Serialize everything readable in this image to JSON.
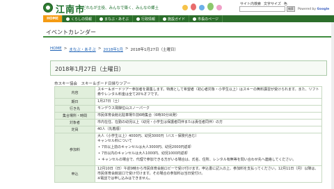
{
  "header": {
    "site_name": "江南市",
    "tagline": "だれもが主役、みんなで築く、みんなの郷土",
    "links": [
      "サイト内検索",
      "文字サイズ",
      "色"
    ],
    "search_button": "検索",
    "powered_label": "Powered by",
    "powered_brand": "Google"
  },
  "nav": {
    "items": [
      "HOME",
      "くらしの情報",
      "まなぶ・あそぶ",
      "行政情報",
      "施設ガイド",
      "市長のページ"
    ]
  },
  "page": {
    "heading": "イベントカレンダー"
  },
  "breadcrumb": {
    "items": [
      "HOME",
      "まなぶ・あそぶ",
      "2018年1月",
      "2018年1月27日（土曜日）"
    ],
    "separator": ">"
  },
  "event": {
    "date_title": "2018年1月27日（土曜日）",
    "name": "市スキー協会　スキー＆ボード日帰りツアー",
    "rows": [
      {
        "label": "内容",
        "value": "スキー＆ボードツアー参加者を募集します。特典として希望者（初心者対象・小学生以上）はスキーの無料講習が受けられます。また、リフト券やレンタル料金は全て20％オフです。"
      },
      {
        "label": "期日",
        "value": "1月27日（土）"
      },
      {
        "label": "行き先",
        "value": "モンデウス飛騨位山スノーパーク"
      },
      {
        "label": "集合場所・時間",
        "value": "市民体育会館北駐車場午前6時集合（6時30分出発）"
      },
      {
        "label": "対象者",
        "value": "市内在住、在勤の幼児以上（幼児・小学生は保護者同伴または責任者同伴）の方"
      },
      {
        "label": "定員",
        "value": "40人（先着順）"
      },
      {
        "label": "参加料",
        "value": "大人（小学生以上）4000円、幼児3000円（バス・保険代含む）",
        "sub": "キャンセル料について",
        "bullets": [
          "7日以上前のキャンセルは大人3000円、幼児2000円返却",
          "7日以内のキャンセルは大人1000円、幼児1000円返却",
          "キャンセルの場合で、代理で参加できる方がいる場合は、氏名、住所、レンタル有無等を問い合わせ先へ連絡してください。"
        ]
      },
      {
        "label": "申込",
        "value": "12月10日（日）午前9時から市民体育会館ロビーで受け付けます。申込書に記入の上、参加料を支払ってください。12月11日（月）以降は、市民体育会館窓口で受け付けます。その場合の参加料は当日受付け。",
        "note": "※電話では申し込みはできません。"
      }
    ]
  },
  "colors": {
    "nav_bg": "#2c6e2b",
    "home_bg": "#f49b13",
    "accent_green": "#3f8c3e",
    "table_header_bg": "#e1efdc"
  }
}
